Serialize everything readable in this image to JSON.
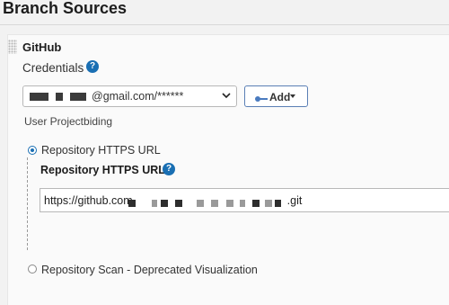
{
  "section_title": "Branch Sources",
  "source": {
    "name": "GitHub",
    "credentials_label": "Credentials",
    "credentials_value": "@gmail.com/******",
    "add_button_label": "Add",
    "user_project_text": "User Projectbiding",
    "options": {
      "https_label": "Repository HTTPS URL",
      "scan_label": "Repository Scan - Deprecated Visualization"
    },
    "url_field_label": "Repository HTTPS URL",
    "url_prefix": "https://github.com",
    "url_suffix": ".git",
    "help_icon_glyph": "?",
    "selected_option": "https"
  },
  "icons": [
    "handle-grip-icon",
    "help-icon",
    "chevron-down-icon",
    "key-icon",
    "caret-down-icon"
  ],
  "colors": {
    "accent": "#1a6fb3",
    "button_border": "#5a7fb5",
    "background": "#f2f2f2"
  }
}
